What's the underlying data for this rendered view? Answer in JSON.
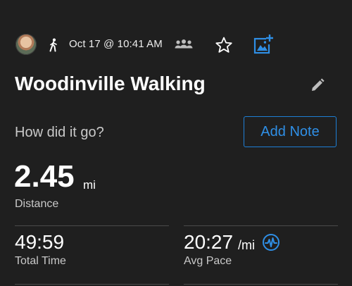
{
  "header": {
    "date": "Oct 17 @ 10:41 AM",
    "icons": [
      "avatar",
      "walking-icon",
      "group-icon",
      "star-icon",
      "add-media-icon"
    ]
  },
  "activity": {
    "title": "Woodinville Walking",
    "edit_icon": "pencil-icon"
  },
  "notes": {
    "prompt": "How did it go?",
    "add_note_label": "Add Note"
  },
  "distance": {
    "value": "2.45",
    "unit": "mi",
    "label": "Distance"
  },
  "stats": [
    {
      "value": "49:59",
      "unit": "",
      "label": "Total Time"
    },
    {
      "value": "20:27",
      "unit": "/mi",
      "label": "Avg Pace",
      "icon": "pace-pulse-icon"
    }
  ],
  "colors": {
    "background": "#1f1f1f",
    "accent": "#2f8fe6",
    "secondary_text": "#c9c9c9"
  }
}
